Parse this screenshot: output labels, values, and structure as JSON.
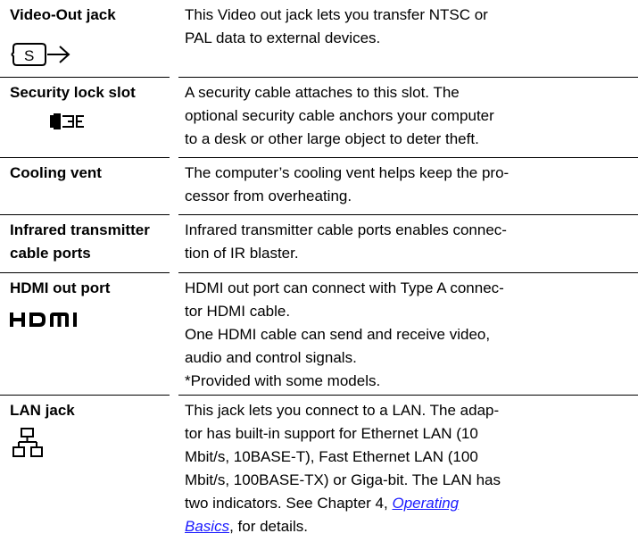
{
  "rows": [
    {
      "term": [
        "Video-Out jack"
      ],
      "icon": "s-video-out-icon",
      "desc": [
        "This Video out  jack lets you transfer NTSC or",
        "PAL data to external devices."
      ]
    },
    {
      "term": [
        "Security lock slot"
      ],
      "icon": "security-lock-icon",
      "desc": [
        "A security cable attaches to this slot. The",
        "optional security cable anchors your computer",
        "to a desk or other large object to deter theft."
      ]
    },
    {
      "term": [
        "Cooling vent"
      ],
      "icon": "",
      "desc": [
        "The computer’s cooling vent helps keep the pro-",
        "cessor from overheating."
      ]
    },
    {
      "term": [
        "Infrared transmitter",
        "cable ports"
      ],
      "icon": "",
      "desc": [
        "Infrared transmitter cable ports enables connec-",
        "tion of IR blaster."
      ]
    },
    {
      "term": [
        "HDMI out port"
      ],
      "icon": "hdmi-logo-icon",
      "icon_text": "HDMI",
      "desc": [
        "HDMI out port can connect with Type A connec-",
        "tor HDMI cable.",
        "One HDMI cable can send and receive video,",
        "audio and control signals.",
        "*Provided with some models."
      ]
    },
    {
      "term": [
        "LAN jack"
      ],
      "icon": "lan-network-icon",
      "desc": [
        "This jack lets you connect to a LAN. The adap-",
        "tor has built-in support for Ethernet LAN (10",
        "Mbit/s, 10BASE-T), Fast Ethernet LAN (100",
        "Mbit/s, 100BASE-TX) or Giga-bit. The LAN has",
        "two indicators. See Chapter 4, "
      ],
      "link_line1": "Operating",
      "link_line2": "Basics",
      "tail": ", for details."
    }
  ],
  "colors": {
    "link": "#1a1aff",
    "rule": "#000000"
  }
}
